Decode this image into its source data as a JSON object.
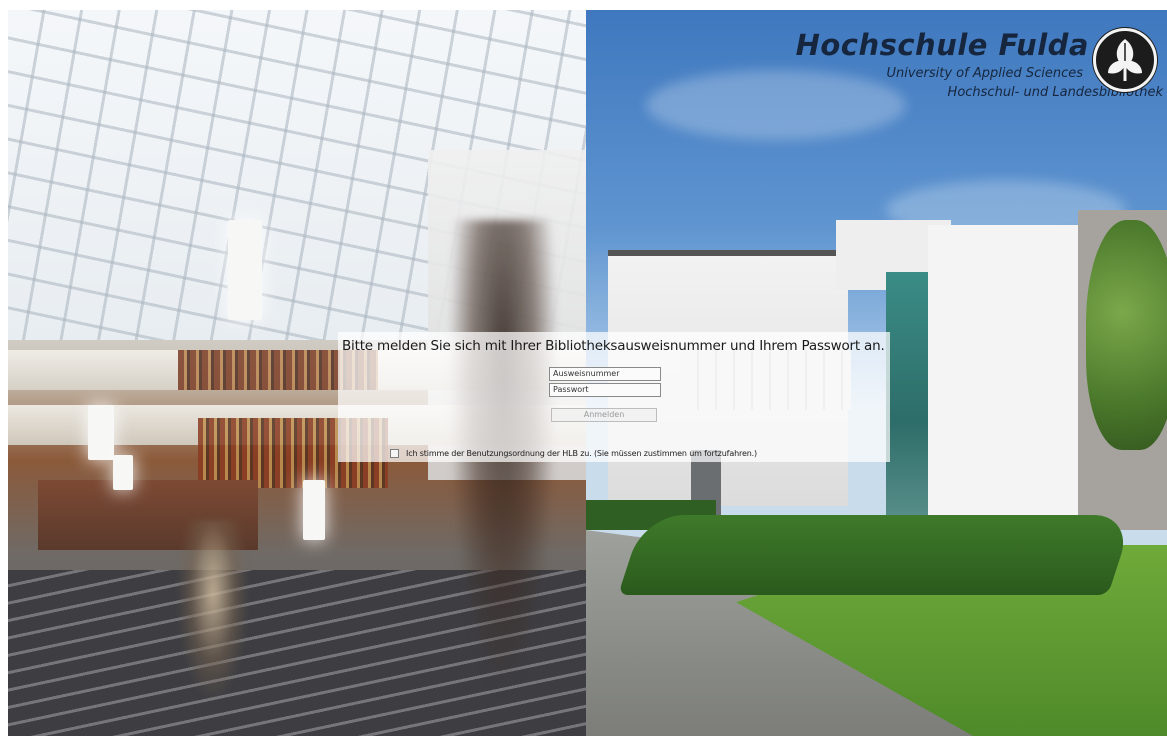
{
  "branding": {
    "title": "Hochschule Fulda",
    "subtitle": "University of Applied Sciences",
    "library": "Hochschul- und Landesbibliothek",
    "logo_icon": "leaf-seal-icon"
  },
  "login": {
    "prompt": "Bitte melden Sie sich mit Ihrer Bibliotheksausweisnummer und Ihrem Passwort an.",
    "username_placeholder": "Ausweisnummer",
    "username_value": "",
    "password_placeholder": "Passwort",
    "password_value": "",
    "submit_label": "Anmelden",
    "consent_label": "Ich stimme der Benutzungsordnung der HLB zu. (Sie müssen zustimmen um fortzufahren.)",
    "consent_checked": false
  },
  "colors": {
    "brand_text": "#16263e",
    "panel_background": "rgba(255,255,255,0.72)",
    "sky": "#3f78bf"
  }
}
